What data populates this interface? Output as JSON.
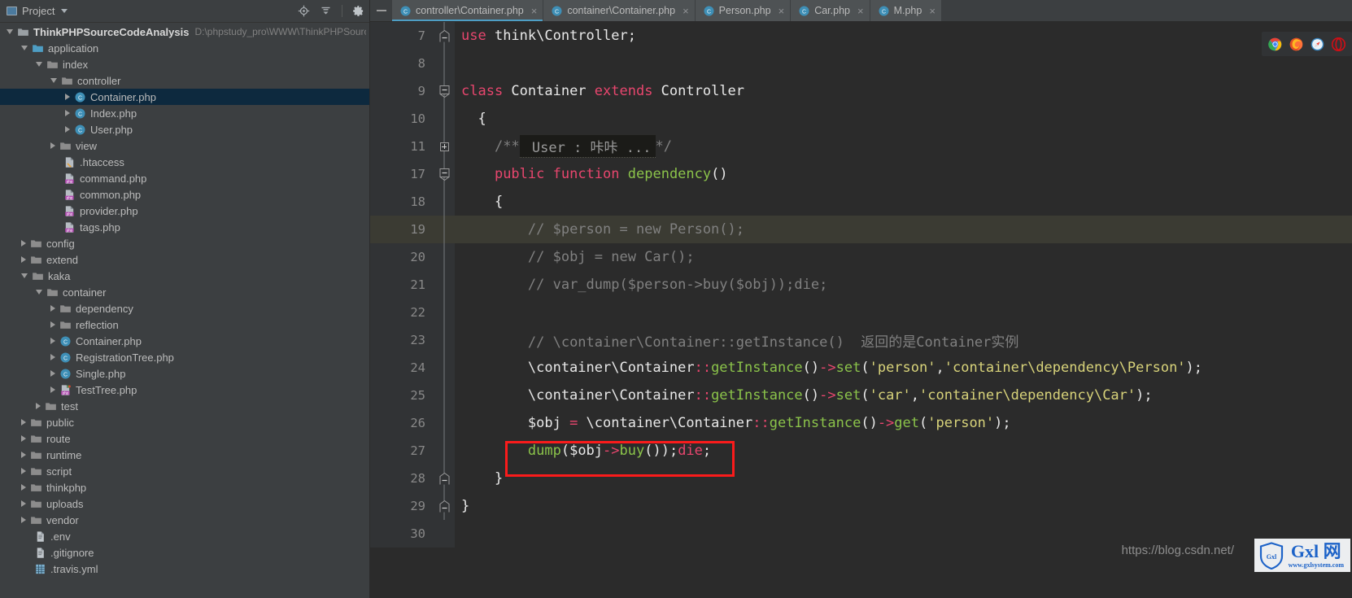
{
  "project_panel": {
    "header": {
      "label": "Project",
      "icons": [
        "project-icon",
        "chevron-down-icon",
        "locate-file-icon",
        "collapse-all-icon",
        "settings-gear-icon"
      ]
    },
    "tree": [
      {
        "depth": 0,
        "arrow": "down",
        "icon": "folder-module",
        "label": "ThinkPHPSourceCodeAnalysis",
        "bold": true,
        "path": "D:\\phpstudy_pro\\WWW\\ThinkPHPSourceCo"
      },
      {
        "depth": 1,
        "arrow": "down",
        "icon": "folder-source",
        "label": "application"
      },
      {
        "depth": 2,
        "arrow": "down",
        "icon": "folder",
        "label": "index"
      },
      {
        "depth": 3,
        "arrow": "down",
        "icon": "folder",
        "label": "controller"
      },
      {
        "depth": 4,
        "arrow": "right",
        "icon": "php-class",
        "label": "Container.php",
        "selected": true
      },
      {
        "depth": 4,
        "arrow": "right",
        "icon": "php-class",
        "label": "Index.php"
      },
      {
        "depth": 4,
        "arrow": "right",
        "icon": "php-class",
        "label": "User.php"
      },
      {
        "depth": 3,
        "arrow": "right",
        "icon": "folder",
        "label": "view"
      },
      {
        "depth": 3,
        "arrow": "none",
        "icon": "htaccess",
        "label": ".htaccess"
      },
      {
        "depth": 3,
        "arrow": "none",
        "icon": "php-file",
        "label": "command.php"
      },
      {
        "depth": 3,
        "arrow": "none",
        "icon": "php-file",
        "label": "common.php"
      },
      {
        "depth": 3,
        "arrow": "none",
        "icon": "php-file",
        "label": "provider.php"
      },
      {
        "depth": 3,
        "arrow": "none",
        "icon": "php-file",
        "label": "tags.php"
      },
      {
        "depth": 1,
        "arrow": "right",
        "icon": "folder",
        "label": "config"
      },
      {
        "depth": 1,
        "arrow": "right",
        "icon": "folder",
        "label": "extend"
      },
      {
        "depth": 1,
        "arrow": "down",
        "icon": "folder",
        "label": "kaka"
      },
      {
        "depth": 2,
        "arrow": "down",
        "icon": "folder",
        "label": "container"
      },
      {
        "depth": 3,
        "arrow": "right",
        "icon": "folder",
        "label": "dependency"
      },
      {
        "depth": 3,
        "arrow": "right",
        "icon": "folder",
        "label": "reflection"
      },
      {
        "depth": 3,
        "arrow": "right",
        "icon": "php-class",
        "label": "Container.php"
      },
      {
        "depth": 3,
        "arrow": "right",
        "icon": "php-class",
        "label": "RegistrationTree.php"
      },
      {
        "depth": 3,
        "arrow": "right",
        "icon": "php-class",
        "label": "Single.php"
      },
      {
        "depth": 3,
        "arrow": "right",
        "icon": "php-file-run",
        "label": "TestTree.php"
      },
      {
        "depth": 2,
        "arrow": "right",
        "icon": "folder",
        "label": "test"
      },
      {
        "depth": 1,
        "arrow": "right",
        "icon": "folder",
        "label": "public"
      },
      {
        "depth": 1,
        "arrow": "right",
        "icon": "folder",
        "label": "route"
      },
      {
        "depth": 1,
        "arrow": "right",
        "icon": "folder",
        "label": "runtime"
      },
      {
        "depth": 1,
        "arrow": "right",
        "icon": "folder",
        "label": "script"
      },
      {
        "depth": 1,
        "arrow": "right",
        "icon": "folder",
        "label": "thinkphp"
      },
      {
        "depth": 1,
        "arrow": "right",
        "icon": "folder",
        "label": "uploads"
      },
      {
        "depth": 1,
        "arrow": "right",
        "icon": "folder",
        "label": "vendor"
      },
      {
        "depth": 1,
        "arrow": "none",
        "icon": "text-file",
        "label": ".env"
      },
      {
        "depth": 1,
        "arrow": "none",
        "icon": "text-file",
        "label": ".gitignore"
      },
      {
        "depth": 1,
        "arrow": "none",
        "icon": "yaml-file",
        "label": ".travis.yml"
      }
    ]
  },
  "tabs": [
    {
      "label": "controller\\Container.php",
      "icon": "php-class",
      "active": true
    },
    {
      "label": "container\\Container.php",
      "icon": "php-class",
      "active": false
    },
    {
      "label": "Person.php",
      "icon": "php-class",
      "active": false
    },
    {
      "label": "Car.php",
      "icon": "php-class",
      "active": false
    },
    {
      "label": "M.php",
      "icon": "php-class",
      "active": false
    }
  ],
  "tab_close_glyph": "×",
  "browser_icons": [
    "chrome-icon",
    "firefox-icon",
    "safari-icon",
    "opera-icon"
  ],
  "editor": {
    "lines": [
      {
        "num": "7",
        "fold": "arrow-top",
        "current": false,
        "tokens": [
          {
            "t": "use",
            "c": "kwp"
          },
          {
            "t": " think\\Controller;",
            "c": "plain"
          }
        ]
      },
      {
        "num": "8",
        "fold": "line",
        "current": false,
        "tokens": []
      },
      {
        "num": "9",
        "fold": "cap-down",
        "current": false,
        "tokens": [
          {
            "t": "class",
            "c": "kwp"
          },
          {
            "t": " Container ",
            "c": "plain"
          },
          {
            "t": "extends",
            "c": "kwp"
          },
          {
            "t": " Controller",
            "c": "plain"
          }
        ]
      },
      {
        "num": "10",
        "fold": "line",
        "current": false,
        "tokens": [
          {
            "t": "  {",
            "c": "plain"
          }
        ]
      },
      {
        "num": "11",
        "fold": "plus",
        "current": false,
        "tokens": [
          {
            "t": "    ",
            "c": "plain"
          },
          {
            "t": "/**",
            "c": "cmt"
          },
          {
            "t": " User : 咔咔 ...",
            "c": "fold"
          },
          {
            "t": "*/",
            "c": "cmt"
          }
        ]
      },
      {
        "num": "17",
        "fold": "minus",
        "current": false,
        "tokens": [
          {
            "t": "    ",
            "c": "plain"
          },
          {
            "t": "public",
            "c": "kwp"
          },
          {
            "t": " ",
            "c": "plain"
          },
          {
            "t": "function",
            "c": "kwp"
          },
          {
            "t": " ",
            "c": "plain"
          },
          {
            "t": "dependency",
            "c": "fn"
          },
          {
            "t": "()",
            "c": "plain"
          }
        ]
      },
      {
        "num": "18",
        "fold": "line",
        "current": false,
        "tokens": [
          {
            "t": "    {",
            "c": "plain"
          }
        ]
      },
      {
        "num": "19",
        "fold": "line",
        "current": true,
        "tokens": [
          {
            "t": "        ",
            "c": "plain"
          },
          {
            "t": "// $person = new Person();",
            "c": "cmt"
          }
        ]
      },
      {
        "num": "20",
        "fold": "line",
        "current": false,
        "tokens": [
          {
            "t": "        ",
            "c": "plain"
          },
          {
            "t": "// $obj = new Car();",
            "c": "cmt"
          }
        ]
      },
      {
        "num": "21",
        "fold": "line",
        "current": false,
        "tokens": [
          {
            "t": "        ",
            "c": "plain"
          },
          {
            "t": "// var_dump($person->buy($obj));die;",
            "c": "cmt"
          }
        ]
      },
      {
        "num": "22",
        "fold": "line",
        "current": false,
        "tokens": []
      },
      {
        "num": "23",
        "fold": "line",
        "current": false,
        "tokens": [
          {
            "t": "        ",
            "c": "plain"
          },
          {
            "t": "// \\container\\Container::getInstance()  返回的是Container实例",
            "c": "cmt"
          }
        ]
      },
      {
        "num": "24",
        "fold": "line",
        "current": false,
        "tokens": [
          {
            "t": "        \\container\\Container",
            "c": "plain"
          },
          {
            "t": "::",
            "c": "pink"
          },
          {
            "t": "getInstance",
            "c": "fn"
          },
          {
            "t": "()",
            "c": "plain"
          },
          {
            "t": "->",
            "c": "pink"
          },
          {
            "t": "set",
            "c": "fn"
          },
          {
            "t": "(",
            "c": "plain"
          },
          {
            "t": "'person'",
            "c": "str"
          },
          {
            "t": ",",
            "c": "plain"
          },
          {
            "t": "'container\\dependency\\Person'",
            "c": "str"
          },
          {
            "t": ");",
            "c": "plain"
          }
        ]
      },
      {
        "num": "25",
        "fold": "line",
        "current": false,
        "tokens": [
          {
            "t": "        \\container\\Container",
            "c": "plain"
          },
          {
            "t": "::",
            "c": "pink"
          },
          {
            "t": "getInstance",
            "c": "fn"
          },
          {
            "t": "()",
            "c": "plain"
          },
          {
            "t": "->",
            "c": "pink"
          },
          {
            "t": "set",
            "c": "fn"
          },
          {
            "t": "(",
            "c": "plain"
          },
          {
            "t": "'car'",
            "c": "str"
          },
          {
            "t": ",",
            "c": "plain"
          },
          {
            "t": "'container\\dependency\\Car'",
            "c": "str"
          },
          {
            "t": ");",
            "c": "plain"
          }
        ]
      },
      {
        "num": "26",
        "fold": "line",
        "current": false,
        "tokens": [
          {
            "t": "        $obj ",
            "c": "plain"
          },
          {
            "t": "=",
            "c": "pink"
          },
          {
            "t": " \\container\\Container",
            "c": "plain"
          },
          {
            "t": "::",
            "c": "pink"
          },
          {
            "t": "getInstance",
            "c": "fn"
          },
          {
            "t": "()",
            "c": "plain"
          },
          {
            "t": "->",
            "c": "pink"
          },
          {
            "t": "get",
            "c": "fn"
          },
          {
            "t": "(",
            "c": "plain"
          },
          {
            "t": "'person'",
            "c": "str"
          },
          {
            "t": ");",
            "c": "plain"
          }
        ]
      },
      {
        "num": "27",
        "fold": "line",
        "current": false,
        "tokens": [
          {
            "t": "        ",
            "c": "plain"
          },
          {
            "t": "dump",
            "c": "fn"
          },
          {
            "t": "($obj",
            "c": "plain"
          },
          {
            "t": "->",
            "c": "pink"
          },
          {
            "t": "buy",
            "c": "fn"
          },
          {
            "t": "());",
            "c": "plain"
          },
          {
            "t": "die",
            "c": "pink"
          },
          {
            "t": ";",
            "c": "plain"
          }
        ]
      },
      {
        "num": "28",
        "fold": "cap-up",
        "current": false,
        "tokens": [
          {
            "t": "    }",
            "c": "plain"
          }
        ]
      },
      {
        "num": "29",
        "fold": "cap-up",
        "current": false,
        "tokens": [
          {
            "t": "}",
            "c": "plain"
          }
        ]
      },
      {
        "num": "30",
        "fold": "none",
        "current": false,
        "tokens": []
      }
    ]
  },
  "annotation": {
    "highlight_color": "#fa1b1b",
    "target_line": "27"
  },
  "watermark": {
    "url": "https://blog.csdn.net/",
    "logo_main": "Gxl 网",
    "logo_sub": "www.gxlsystem.com",
    "logo_shield_text": "Gxl"
  }
}
